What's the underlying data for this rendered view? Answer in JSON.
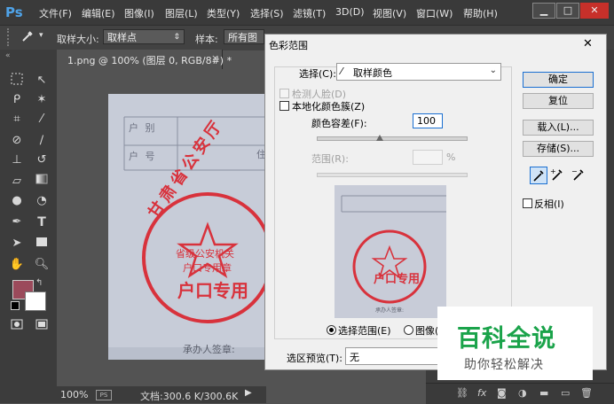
{
  "app": {
    "logo": "Ps"
  },
  "menu": [
    "文件(F)",
    "编辑(E)",
    "图像(I)",
    "图层(L)",
    "类型(Y)",
    "选择(S)",
    "滤镜(T)",
    "3D(D)",
    "视图(V)",
    "窗口(W)",
    "帮助(H)"
  ],
  "window_controls": {
    "minimize": "▁",
    "maximize": "□",
    "close": "✕"
  },
  "options_bar": {
    "sample_size_label": "取样大小:",
    "sample_size_value": "取样点",
    "sample_label": "样本:",
    "sample_value": "所有图层"
  },
  "document": {
    "tab_title": "1.png @ 100% (图层 0, RGB/8#) *",
    "tab_close": "×",
    "zoom": "100%",
    "doc_info": "文档:300.6 K/300.6K"
  },
  "stamp": {
    "row1": "户  别",
    "row2": "户  号",
    "row2_right": "住",
    "ring_text": "甘肃省公安厅",
    "center_line1": "省级公安机关",
    "center_line2": "户口专用章",
    "big_text": "户口专用",
    "footer": "承办人签章:"
  },
  "dialog": {
    "title": "色彩范围",
    "close": "✕",
    "select_label": "选择(C):",
    "select_value": "取样颜色",
    "detect_faces": "检测人脸(D)",
    "localized_clusters": "本地化颜色簇(Z)",
    "fuzziness_label": "颜色容差(F):",
    "fuzziness_value": "100",
    "fuzziness_fraction": 0.42,
    "range_label": "范围(R):",
    "range_unit": "%",
    "radio_selection": "选择范围(E)",
    "radio_image": "图像(",
    "preview_label": "选区预览(T):",
    "preview_value": "无",
    "buttons": {
      "ok": "确定",
      "reset": "复位",
      "load": "载入(L)...",
      "save": "存储(S)..."
    },
    "invert": "反相(I)"
  },
  "watermark": {
    "title": "百科全说",
    "subtitle": "助你轻松解决"
  },
  "colors": {
    "foreground": "#9b4a5b",
    "background": "#ffffff",
    "stamp_red": "#d8323c",
    "accent_blue": "#1a6fd1"
  }
}
